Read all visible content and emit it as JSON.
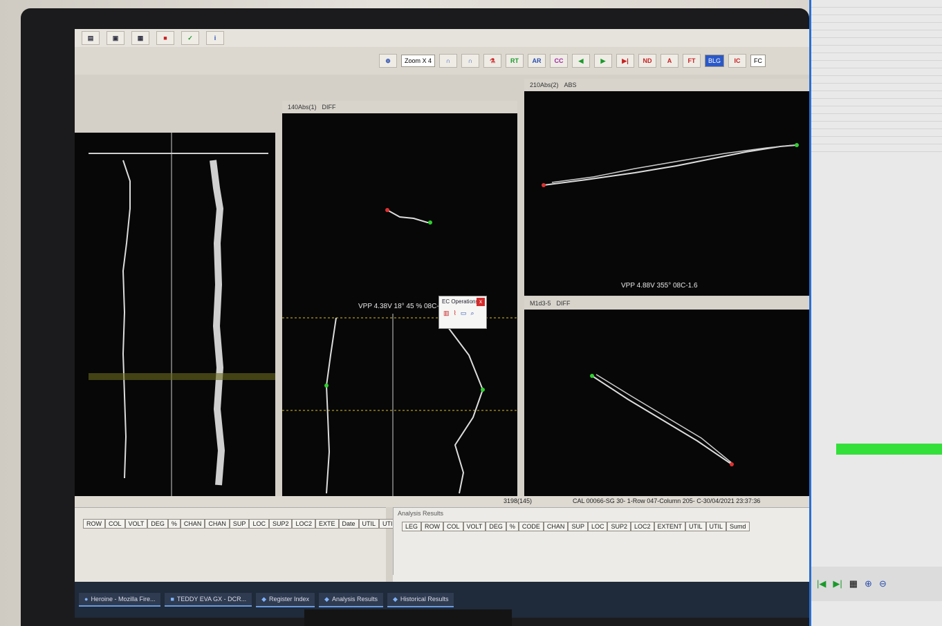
{
  "screen": {
    "popup": {
      "title": "EC Operations",
      "close": "x"
    },
    "readouts": {
      "top_right": "VPP 4.88V 355° 08C-1.6",
      "mid": "VPP 4.38V 18° 45 % 08C-1.6"
    },
    "panel_headers": {
      "left_mid": "140Abs(1)",
      "left_mid_mode": "DIFF",
      "right_top": "210Abs(2)",
      "right_top_mode": "ABS",
      "right_bottom": "M1d3-5",
      "right_bottom_mode": "DIFF"
    },
    "toolbar": {
      "zoom": "Zoom X 4",
      "rt": "RT",
      "ar": "AR",
      "cc": "CC",
      "nd": "ND",
      "a": "A",
      "ft": "FT",
      "blg": "BLG",
      "ic": "IC",
      "fc": "FC"
    },
    "status": {
      "position": "3198(145)",
      "cal": "CAL 00066-SG 30- 1-Row 047-Column 205- C-30/04/2021 23:37:36"
    },
    "analysis_results": {
      "title": "Analysis Results",
      "columns": [
        "LEG",
        "ROW",
        "COL",
        "VOLT",
        "DEG",
        "%",
        "CODE",
        "CHAN",
        "SUP",
        "LOC",
        "SUP2",
        "LOC2",
        "EXTENT",
        "UTIL",
        "UTIL",
        "Sumd"
      ]
    },
    "left_results": {
      "columns": [
        "ROW",
        "COL",
        "VOLT",
        "DEG",
        "%",
        "CHAN",
        "CHAN",
        "SUP",
        "LOC",
        "SUP2",
        "LOC2",
        "EXTE",
        "Date",
        "UTIL",
        "UTIL"
      ]
    },
    "taskbar": {
      "items": [
        "Heroine - Mozilla Fire...",
        "TEDDY EVA GX - DCR...",
        "Register Index",
        "Analysis Results",
        "Historical Results"
      ]
    }
  }
}
